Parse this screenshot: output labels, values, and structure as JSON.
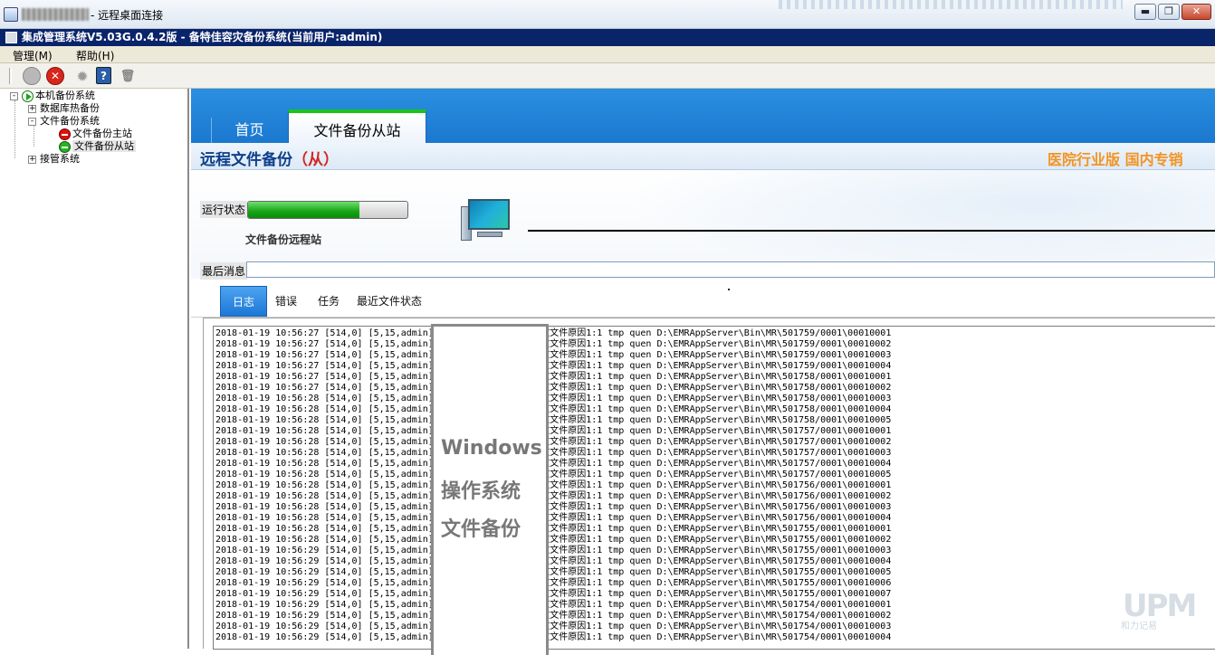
{
  "remote_window": {
    "title": "- 远程桌面连接",
    "buttons": {
      "minimize": "▬",
      "restore": "❐",
      "close": "✕"
    }
  },
  "app": {
    "title": "集成管理系统V5.03G.0.4.2版  - 备特佳容灾备份系统(当前用户:admin)"
  },
  "menu": [
    {
      "label": "管理(M)"
    },
    {
      "label": "帮助(H)"
    }
  ],
  "toolbar": {
    "buttons": [
      {
        "icon": "disabled-circle-icon"
      },
      {
        "icon": "stop-icon",
        "glyph": "✕"
      },
      {
        "icon": "gear-icon",
        "glyph": "✹"
      },
      {
        "icon": "help-icon",
        "glyph": "?"
      },
      {
        "icon": "trash-icon",
        "glyph": "🗑"
      }
    ]
  },
  "tree": {
    "root": "本机备份系统",
    "items": [
      {
        "label": "数据库热备份",
        "toggle": "+"
      },
      {
        "label": "文件备份系统",
        "toggle": "-"
      },
      {
        "label": "文件备份主站",
        "status": "red"
      },
      {
        "label": "文件备份从站",
        "status": "green",
        "selected": true
      },
      {
        "label": "接管系统",
        "toggle": "+"
      }
    ]
  },
  "main": {
    "tabs": [
      {
        "label": "首页",
        "active": false
      },
      {
        "label": "文件备份从站",
        "active": true
      }
    ],
    "header": {
      "title": "远程文件备份",
      "title_suffix": "（从）",
      "edition": "医院行业版  国内专销"
    },
    "status": {
      "run_label": "运行状态",
      "progress_percent": 70,
      "station_label": "文件备份远程站",
      "last_message_label": "最后消息",
      "last_message_value": ""
    },
    "subtabs": [
      {
        "label": "日志",
        "active": true
      },
      {
        "label": "错误",
        "active": false
      },
      {
        "label": "任务",
        "active": false
      },
      {
        "label": "最近文件状态",
        "active": false
      }
    ],
    "log": {
      "lines": [
        "2018-01-19 10:56:27 [514,0] [5,15,admin]                  接收文件原因1:1 tmp quen D:\\EMRAppServer\\Bin\\MR\\501759/0001\\00010001",
        "2018-01-19 10:56:27 [514,0] [5,15,admin]                  接收文件原因1:1 tmp quen D:\\EMRAppServer\\Bin\\MR\\501759/0001\\00010002",
        "2018-01-19 10:56:27 [514,0] [5,15,admin]                  接收文件原因1:1 tmp quen D:\\EMRAppServer\\Bin\\MR\\501759/0001\\00010003",
        "2018-01-19 10:56:27 [514,0] [5,15,admin]                  接收文件原因1:1 tmp quen D:\\EMRAppServer\\Bin\\MR\\501759/0001\\00010004",
        "2018-01-19 10:56:27 [514,0] [5,15,admin]                  接收文件原因1:1 tmp quen D:\\EMRAppServer\\Bin\\MR\\501758/0001\\00010001",
        "2018-01-19 10:56:27 [514,0] [5,15,admin]                  接收文件原因1:1 tmp quen D:\\EMRAppServer\\Bin\\MR\\501758/0001\\00010002",
        "2018-01-19 10:56:28 [514,0] [5,15,admin]                  接收文件原因1:1 tmp quen D:\\EMRAppServer\\Bin\\MR\\501758/0001\\00010003",
        "2018-01-19 10:56:28 [514,0] [5,15,admin]                  接收文件原因1:1 tmp quen D:\\EMRAppServer\\Bin\\MR\\501758/0001\\00010004",
        "2018-01-19 10:56:28 [514,0] [5,15,admin]                  接收文件原因1:1 tmp quen D:\\EMRAppServer\\Bin\\MR\\501758/0001\\00010005",
        "2018-01-19 10:56:28 [514,0] [5,15,admin]                  接收文件原因1:1 tmp quen D:\\EMRAppServer\\Bin\\MR\\501757/0001\\00010001",
        "2018-01-19 10:56:28 [514,0] [5,15,admin]                  接收文件原因1:1 tmp quen D:\\EMRAppServer\\Bin\\MR\\501757/0001\\00010002",
        "2018-01-19 10:56:28 [514,0] [5,15,admin]                  接收文件原因1:1 tmp quen D:\\EMRAppServer\\Bin\\MR\\501757/0001\\00010003",
        "2018-01-19 10:56:28 [514,0] [5,15,admin]                  接收文件原因1:1 tmp quen D:\\EMRAppServer\\Bin\\MR\\501757/0001\\00010004",
        "2018-01-19 10:56:28 [514,0] [5,15,admin]                  接收文件原因1:1 tmp quen D:\\EMRAppServer\\Bin\\MR\\501757/0001\\00010005",
        "2018-01-19 10:56:28 [514,0] [5,15,admin]                  接收文件原因1:1 tmp quen D:\\EMRAppServer\\Bin\\MR\\501756/0001\\00010001",
        "2018-01-19 10:56:28 [514,0] [5,15,admin]                  接收文件原因1:1 tmp quen D:\\EMRAppServer\\Bin\\MR\\501756/0001\\00010002",
        "2018-01-19 10:56:28 [514,0] [5,15,admin]                  接收文件原因1:1 tmp quen D:\\EMRAppServer\\Bin\\MR\\501756/0001\\00010003",
        "2018-01-19 10:56:28 [514,0] [5,15,admin]                  接收文件原因1:1 tmp quen D:\\EMRAppServer\\Bin\\MR\\501756/0001\\00010004",
        "2018-01-19 10:56:28 [514,0] [5,15,admin]                  接收文件原因1:1 tmp quen D:\\EMRAppServer\\Bin\\MR\\501755/0001\\00010001",
        "2018-01-19 10:56:28 [514,0] [5,15,admin]                  接收文件原因1:1 tmp quen D:\\EMRAppServer\\Bin\\MR\\501755/0001\\00010002",
        "2018-01-19 10:56:29 [514,0] [5,15,admin]                  接收文件原因1:1 tmp quen D:\\EMRAppServer\\Bin\\MR\\501755/0001\\00010003",
        "2018-01-19 10:56:29 [514,0] [5,15,admin]                  接收文件原因1:1 tmp quen D:\\EMRAppServer\\Bin\\MR\\501755/0001\\00010004",
        "2018-01-19 10:56:29 [514,0] [5,15,admin]                  接收文件原因1:1 tmp quen D:\\EMRAppServer\\Bin\\MR\\501755/0001\\00010005",
        "2018-01-19 10:56:29 [514,0] [5,15,admin]                  接收文件原因1:1 tmp quen D:\\EMRAppServer\\Bin\\MR\\501755/0001\\00010006",
        "2018-01-19 10:56:29 [514,0] [5,15,admin]                  接收文件原因1:1 tmp quen D:\\EMRAppServer\\Bin\\MR\\501755/0001\\00010007",
        "2018-01-19 10:56:29 [514,0] [5,15,admin]                  接收文件原因1:1 tmp quen D:\\EMRAppServer\\Bin\\MR\\501754/0001\\00010001",
        "2018-01-19 10:56:29 [514,0] [5,15,admin]                  接收文件原因1:1 tmp quen D:\\EMRAppServer\\Bin\\MR\\501754/0001\\00010002",
        "2018-01-19 10:56:29 [514,0] [5,15,admin]                  接收文件原因1:1 tmp quen D:\\EMRAppServer\\Bin\\MR\\501754/0001\\00010003",
        "2018-01-19 10:56:29 [514,0] [5,15,admin]                  接收文件原因1:1 tmp quen D:\\EMRAppServer\\Bin\\MR\\501754/0001\\00010004"
      ]
    },
    "overlay": {
      "line1": "Windows",
      "line2": "操作系统",
      "line3": "文件备份"
    }
  },
  "watermark": {
    "logo": "UPM",
    "sub": "和力记易"
  },
  "colors": {
    "app_titlebar": "#0a246a",
    "banner": "#1b78cf",
    "header_title": "#0d3f8a",
    "slave_text": "#d0261f",
    "edition_text": "#f39422",
    "progress_green": "#16a416"
  }
}
